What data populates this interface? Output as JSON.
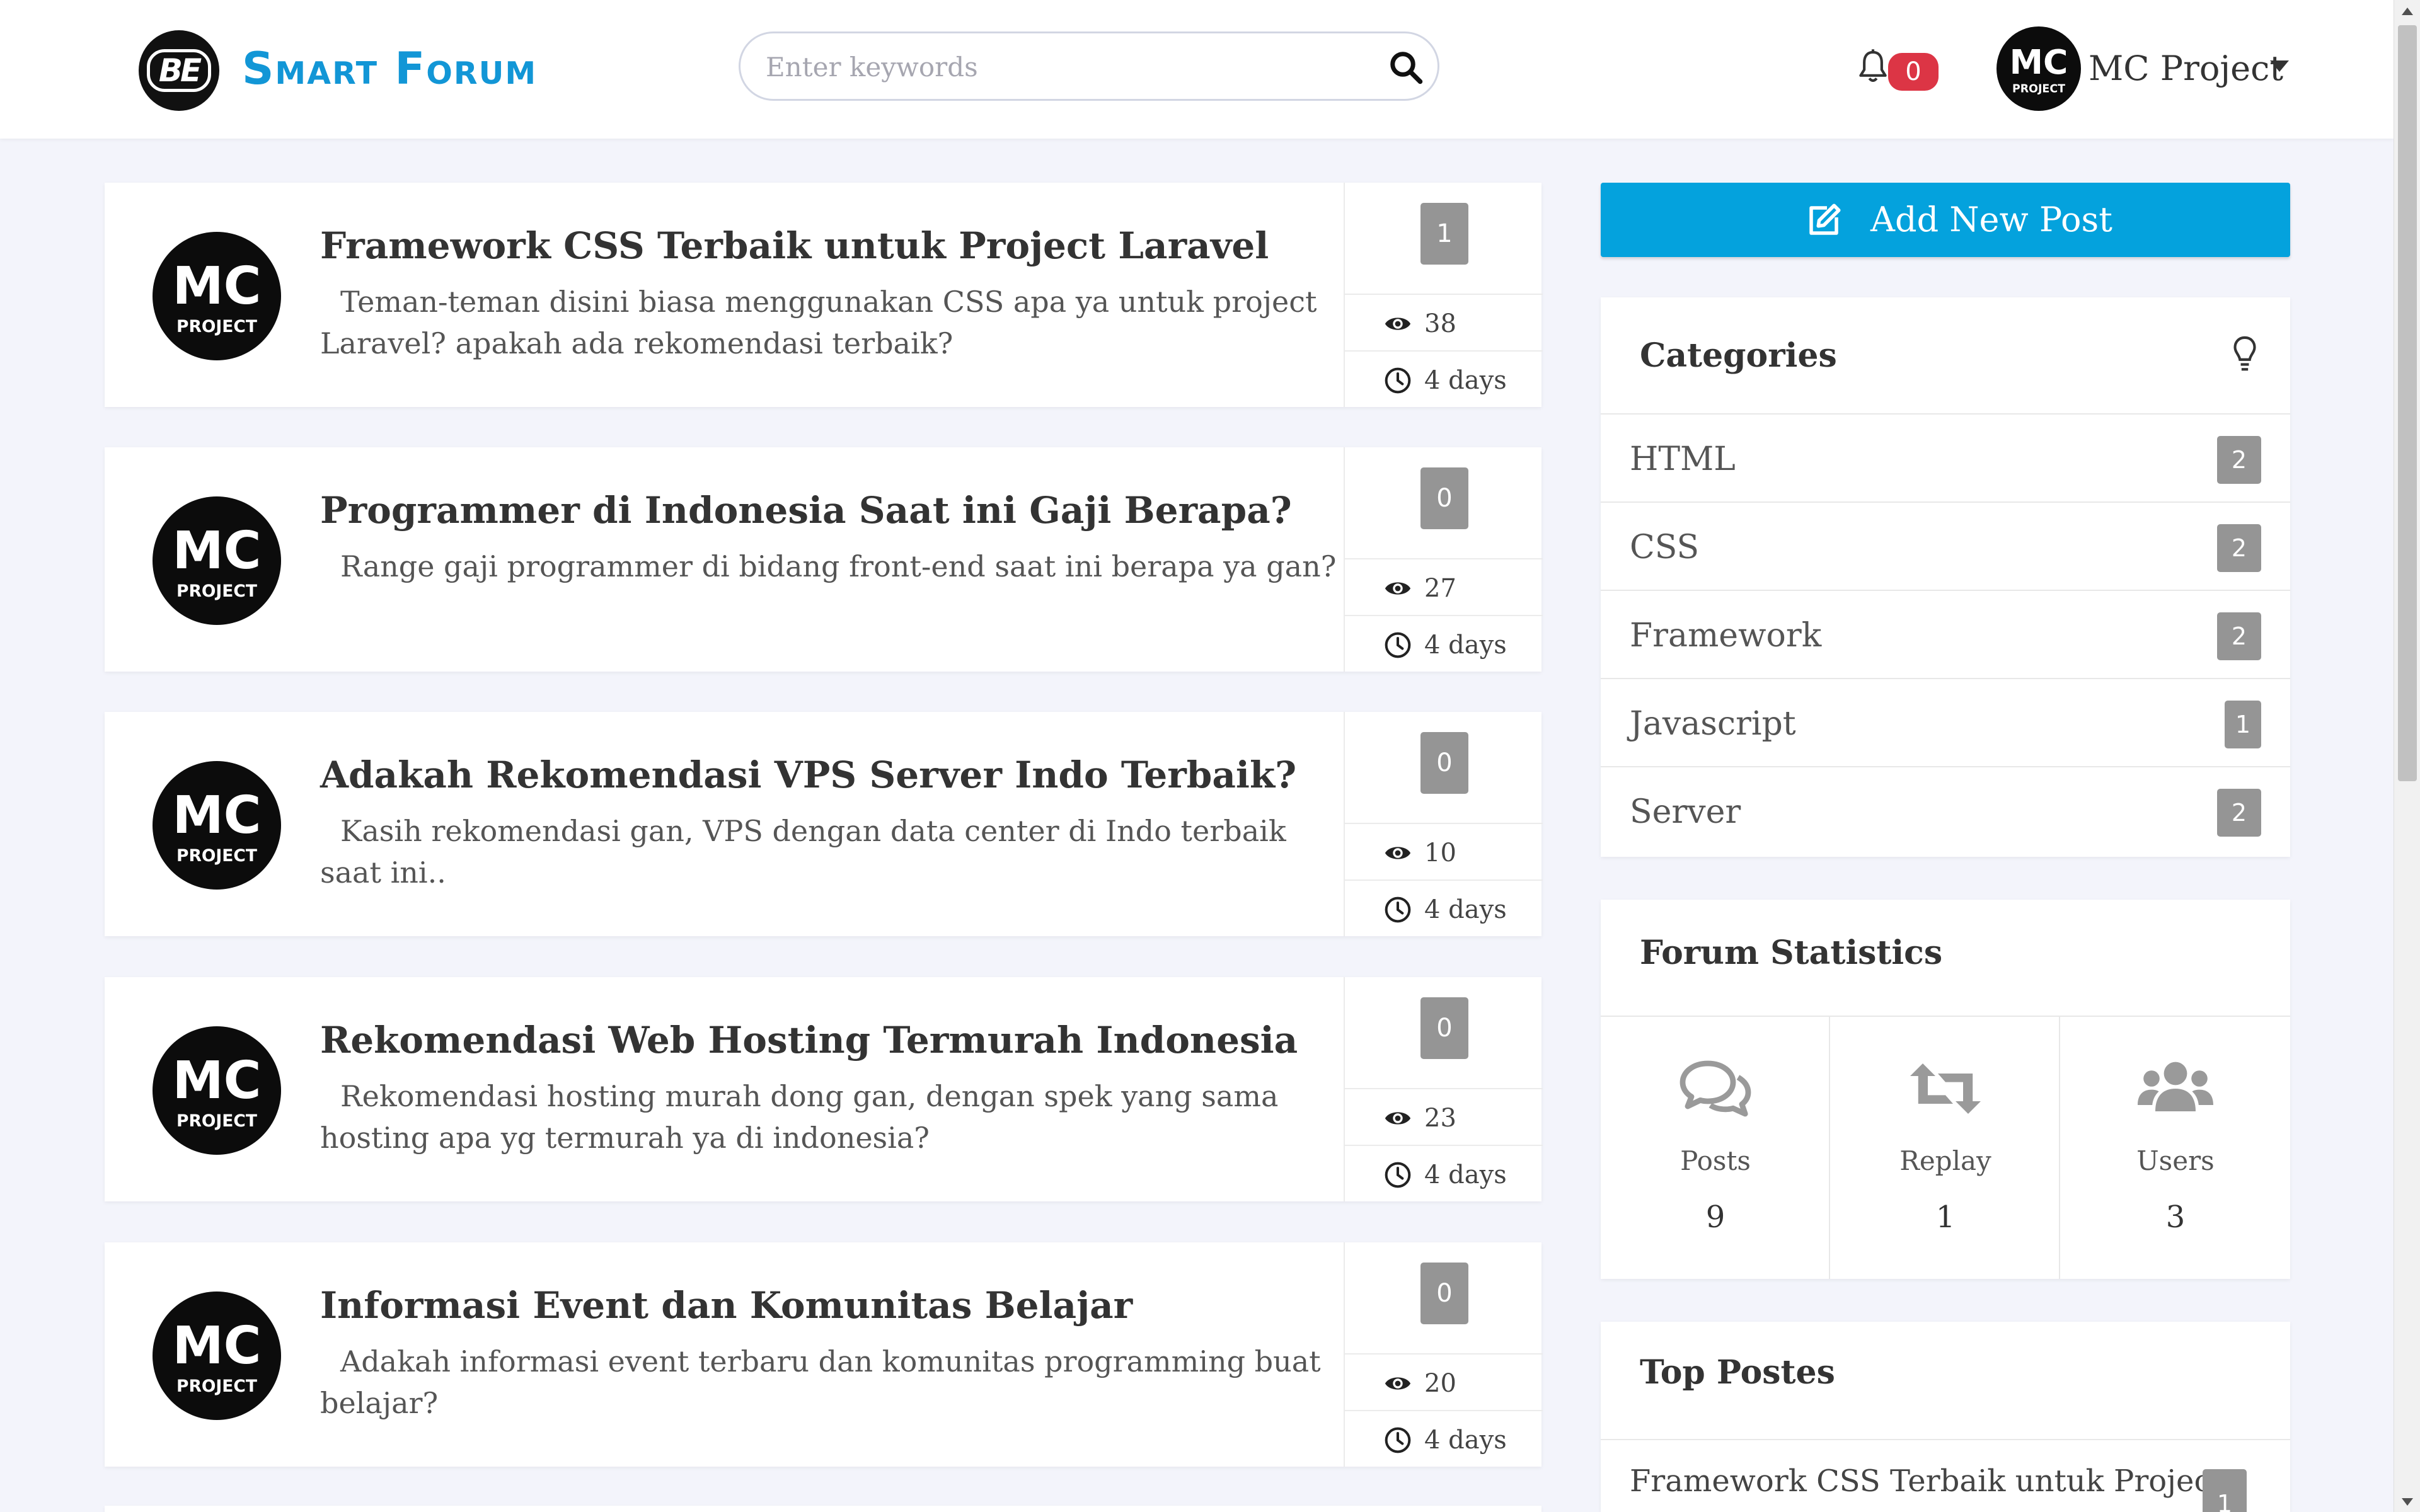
{
  "header": {
    "logo_text": "BE",
    "brand": "Smart Forum",
    "search_placeholder": "Enter keywords",
    "notification_count": "0",
    "user_name": "MC Project"
  },
  "posts": [
    {
      "title": "Framework CSS Terbaik untuk Project Laravel",
      "excerpt": "Teman-teman disini biasa menggunakan CSS apa ya untuk project Laravel? apakah ada rekomendasi terbaik?",
      "replies": "1",
      "views": "38",
      "time": "4 days"
    },
    {
      "title": "Programmer di Indonesia Saat ini Gaji Berapa?",
      "excerpt": "Range gaji programmer di bidang front-end saat ini berapa ya gan?",
      "replies": "0",
      "views": "27",
      "time": "4 days"
    },
    {
      "title": "Adakah Rekomendasi VPS Server Indo Terbaik?",
      "excerpt": "Kasih rekomendasi gan, VPS dengan data center di Indo terbaik saat ini..",
      "replies": "0",
      "views": "10",
      "time": "4 days"
    },
    {
      "title": "Rekomendasi Web Hosting Termurah Indonesia",
      "excerpt": "Rekomendasi hosting murah dong gan, dengan spek yang sama hosting apa yg termurah ya di indonesia?",
      "replies": "0",
      "views": "23",
      "time": "4 days"
    },
    {
      "title": "Informasi Event dan Komunitas Belajar",
      "excerpt": "Adakah informasi event terbaru dan komunitas programming buat belajar?",
      "replies": "0",
      "views": "20",
      "time": "4 days"
    }
  ],
  "sidebar": {
    "add_post_label": "Add New Post",
    "categories": {
      "title": "Categories",
      "items": [
        {
          "label": "HTML",
          "count": "2"
        },
        {
          "label": "CSS",
          "count": "2"
        },
        {
          "label": "Framework",
          "count": "2"
        },
        {
          "label": "Javascript",
          "count": "1"
        },
        {
          "label": "Server",
          "count": "2"
        }
      ]
    },
    "statistics": {
      "title": "Forum Statistics",
      "items": [
        {
          "label": "Posts",
          "value": "9",
          "icon": "comments-icon"
        },
        {
          "label": "Replay",
          "value": "1",
          "icon": "retweet-icon"
        },
        {
          "label": "Users",
          "value": "3",
          "icon": "users-icon"
        }
      ]
    },
    "top_posts": {
      "title": "Top Postes",
      "items": [
        {
          "title": "Framework CSS Terbaik untuk Project",
          "count": "1"
        }
      ]
    }
  },
  "colors": {
    "accent": "#04a2dd",
    "brand": "#1296d6",
    "badge_gray": "#959595",
    "notification_red": "#dc3545",
    "page_background": "#f3f4fb"
  }
}
